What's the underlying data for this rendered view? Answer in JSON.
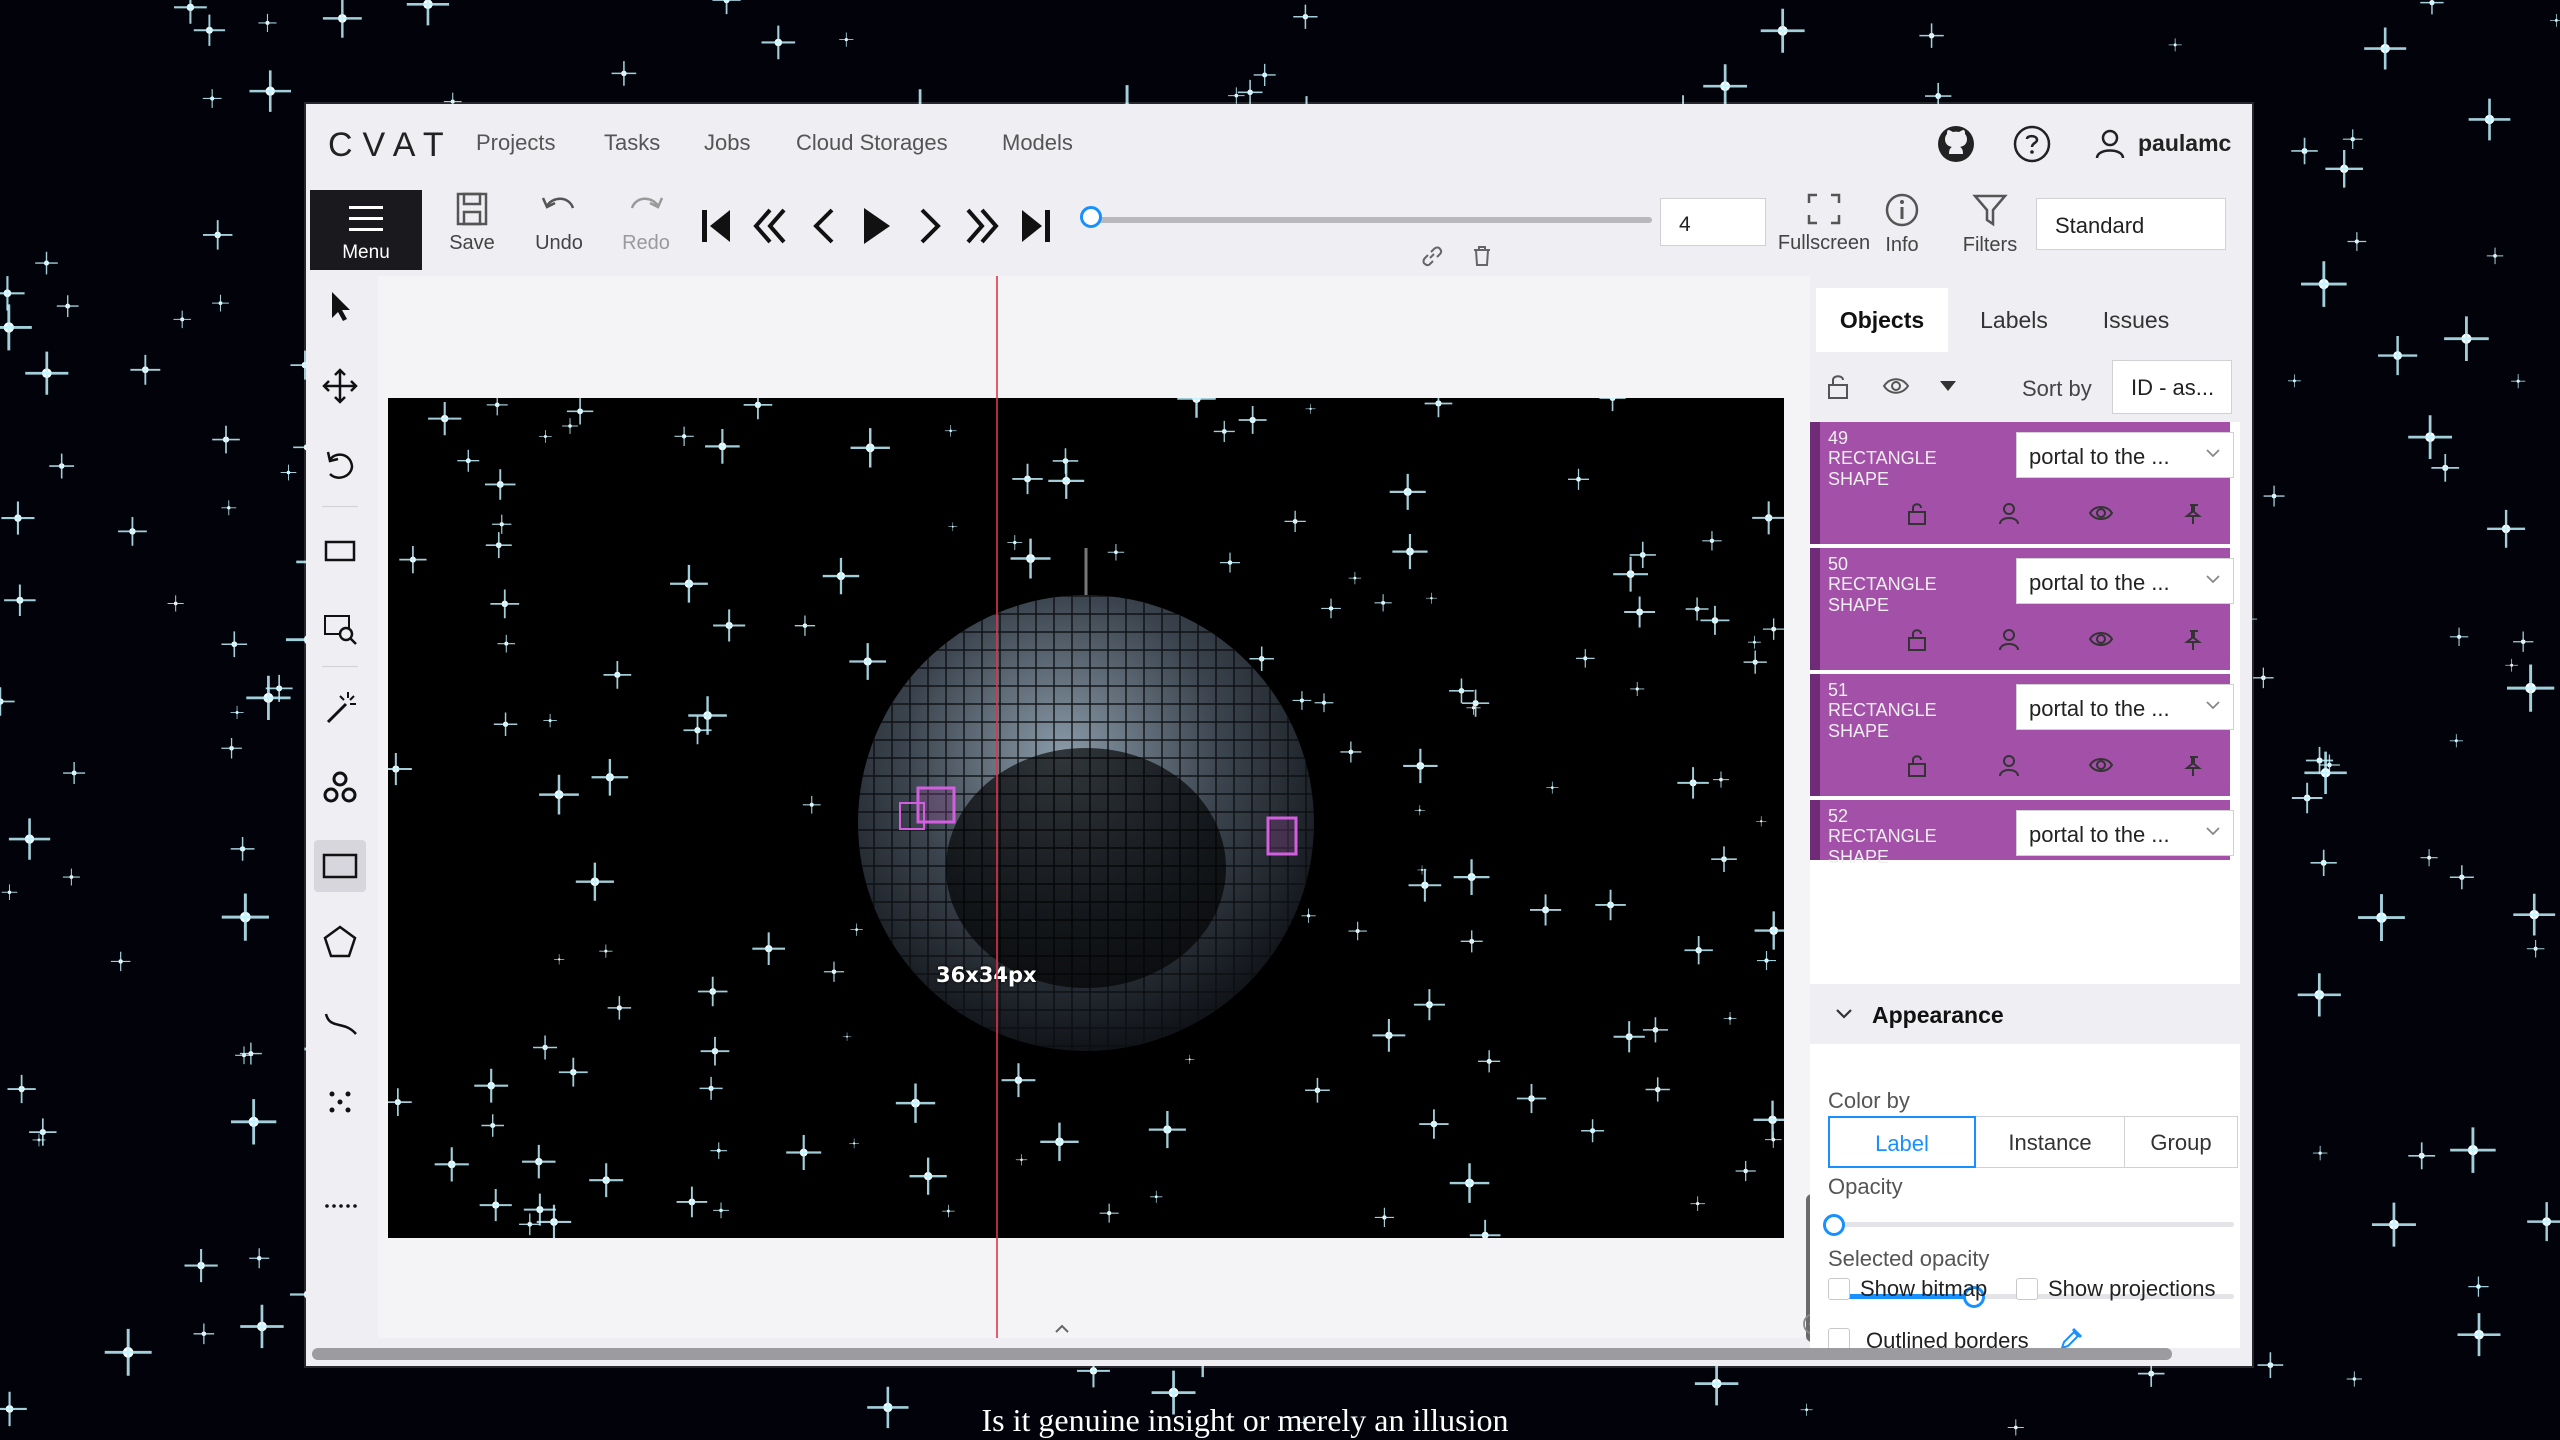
{
  "app": {
    "logo": "CVAT",
    "nav": [
      "Projects",
      "Tasks",
      "Jobs",
      "Cloud Storages",
      "Models"
    ],
    "user": "paulamc"
  },
  "toolbar": {
    "menu_label": "Menu",
    "save_label": "Save",
    "undo_label": "Undo",
    "redo_label": "Redo",
    "frame_number": "4",
    "fullscreen_label": "Fullscreen",
    "info_label": "Info",
    "filters_label": "Filters",
    "workspace": "Standard"
  },
  "canvas": {
    "size_label": "36x34px"
  },
  "sidebar": {
    "tabs": [
      "Objects",
      "Labels",
      "Issues"
    ],
    "active_tab": "Objects",
    "sort_label": "Sort by",
    "sort_value": "ID - as...",
    "objects": [
      {
        "id": "49",
        "type": "RECTANGLE SHAPE",
        "label": "portal to the ..."
      },
      {
        "id": "50",
        "type": "RECTANGLE SHAPE",
        "label": "portal to the ..."
      },
      {
        "id": "51",
        "type": "RECTANGLE SHAPE",
        "label": "portal to the ..."
      },
      {
        "id": "52",
        "type": "RECTANGLE SHAPE",
        "label": "portal to the ..."
      }
    ],
    "object_color": "#a350a8",
    "appearance": {
      "title": "Appearance",
      "color_by_label": "Color by",
      "color_by_options": [
        "Label",
        "Instance",
        "Group"
      ],
      "color_by_selected": "Label",
      "opacity_label": "Opacity",
      "opacity_value": 0,
      "selected_opacity_label": "Selected opacity",
      "selected_opacity_value": 0.35,
      "outlined_borders_label": "Outlined borders",
      "show_bitmap_label": "Show bitmap",
      "show_projections_label": "Show projections"
    }
  },
  "subtitle": "Is it genuine insight or merely an illusion",
  "accent_color": "#1890ff"
}
